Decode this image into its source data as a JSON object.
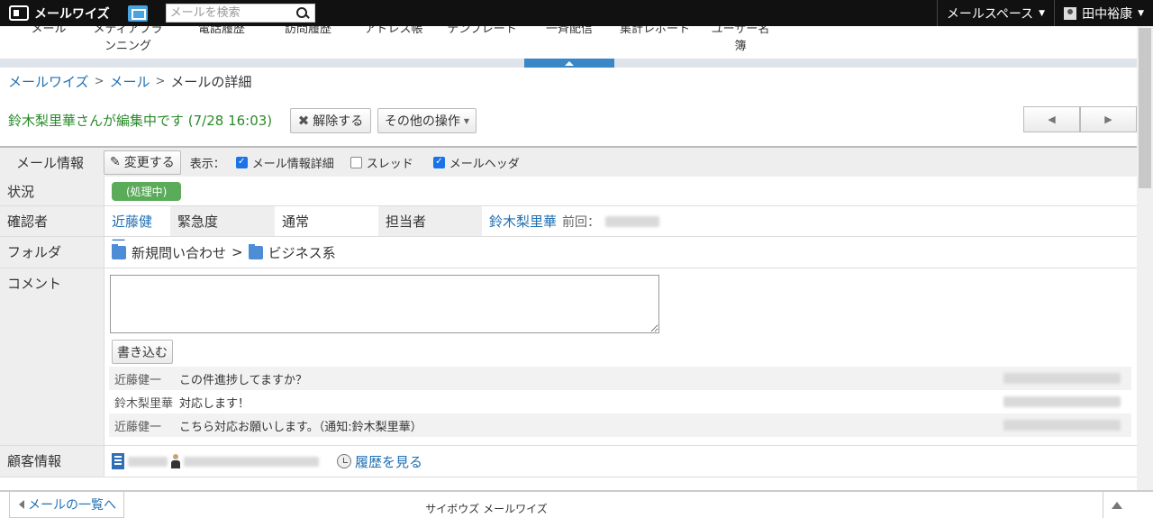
{
  "app": {
    "name": "メールワイズ"
  },
  "search": {
    "placeholder": "メールを検索"
  },
  "topmenu": {
    "space": "メールスペース",
    "user": "田中裕康"
  },
  "nav": [
    "メール",
    "メディアプランニング",
    "電話履歴",
    "訪問履歴",
    "アドレス帳",
    "テンプレート",
    "一斉配信",
    "集計レポート",
    "ユーザー名簿"
  ],
  "breadcrumb": {
    "root": "メールワイズ",
    "mail": "メール",
    "current": "メールの詳細"
  },
  "editing": {
    "text": "鈴木梨里華さんが編集中です (7/28 16:03)",
    "release": "解除する",
    "other": "その他の操作"
  },
  "pager": {
    "prev": "◀",
    "next": "▶"
  },
  "info": {
    "title": "メール情報",
    "change": "変更する",
    "display": "表示：",
    "opt_detail": "メール情報詳細",
    "opt_thread": "スレッド",
    "opt_header": "メールヘッダ"
  },
  "rows": {
    "status_label": "状況",
    "status_value": "(処理中)",
    "confirm_label": "確認者",
    "confirm_value": "近藤健一",
    "urgency_label": "緊急度",
    "urgency_value": "通常",
    "assignee_label": "担当者",
    "assignee_value": "鈴木梨里華",
    "last_label": "前回：",
    "folder_label": "フォルダ",
    "folder1": "新規問い合わせ",
    "folder_sep": ">",
    "folder2": "ビジネス系",
    "comment_label": "コメント",
    "write": "書き込む",
    "customer_label": "顧客情報",
    "history": "履歴を見る"
  },
  "comments": [
    {
      "user": "近藤健一",
      "text": "この件進捗してますか？"
    },
    {
      "user": "鈴木梨里華",
      "text": "対応します！"
    },
    {
      "user": "近藤健一",
      "text": "こちら対応お願いします。（通知:鈴木梨里華）"
    }
  ],
  "footer": {
    "back": "メールの一覧へ",
    "brand": "サイボウズ メールワイズ"
  }
}
